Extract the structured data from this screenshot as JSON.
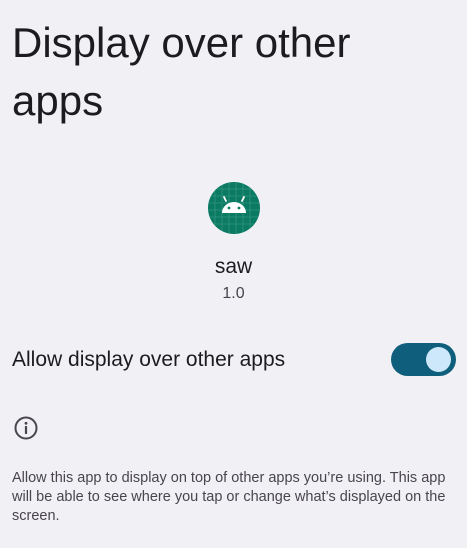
{
  "page": {
    "title": "Display over other apps"
  },
  "app": {
    "name": "saw",
    "version": "1.0",
    "icon": "android-app-icon",
    "icon_color": "#0a7a63"
  },
  "permission": {
    "label": "Allow display over other apps",
    "enabled": true,
    "track_color": "#0f5e7c",
    "thumb_color": "#cde8fb"
  },
  "footer": {
    "icon": "info-icon",
    "text": "Allow this app to display on top of other apps you’re using. This app will be able to see where you tap or change what’s displayed on the screen."
  }
}
